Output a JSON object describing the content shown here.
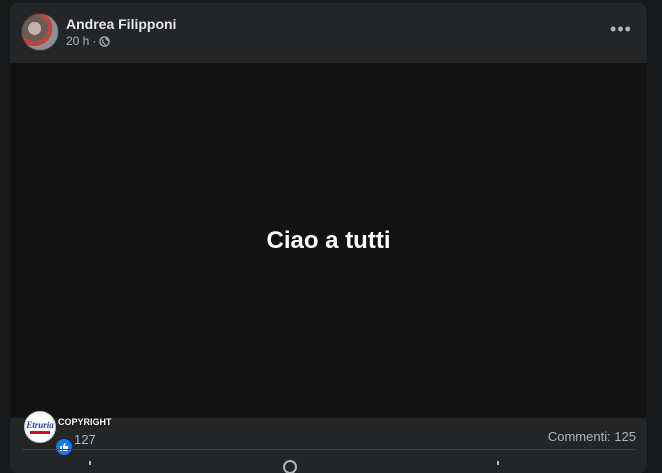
{
  "post": {
    "author": "Andrea Filipponi",
    "time": "20 h",
    "separator": "·",
    "privacy_icon": "globe-icon",
    "more_icon": "more-options-icon",
    "text": "Ciao a tutti"
  },
  "stats": {
    "reaction_count": "127",
    "comments": "Commenti: 125"
  },
  "watermark": {
    "logo_text": "Etruria",
    "label": "COPYRIGHT"
  },
  "colors": {
    "background": "#18191a",
    "card": "#242526",
    "post_background": "#121212",
    "like_blue": "#1877f2"
  }
}
